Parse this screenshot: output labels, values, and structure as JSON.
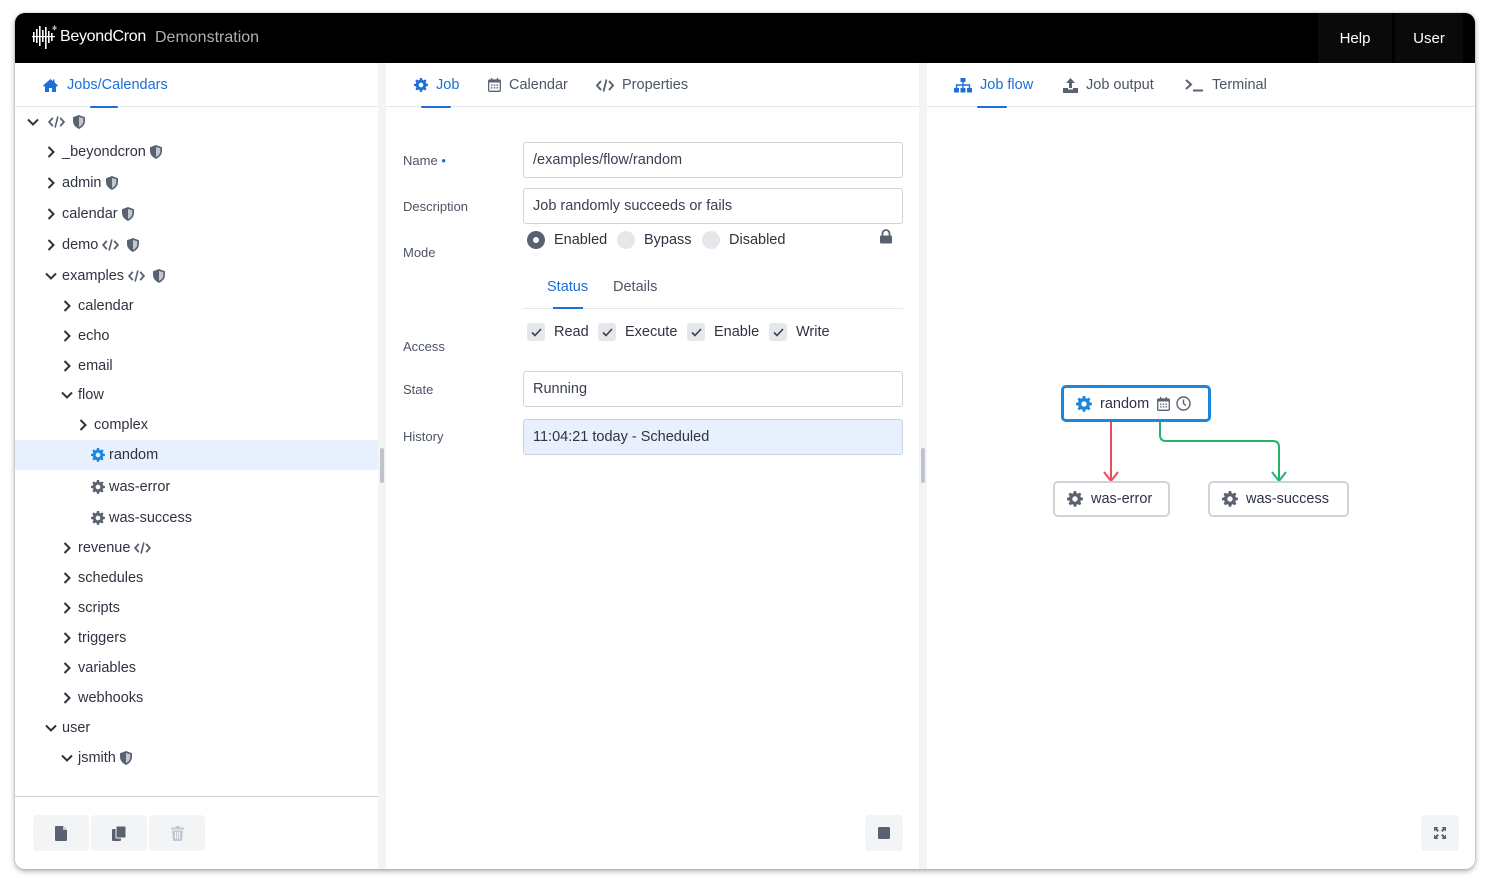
{
  "header": {
    "brand": "BeyondCron",
    "subtitle": "Demonstration",
    "help_label": "Help",
    "user_label": "User"
  },
  "left_panel": {
    "tab_label": "Jobs/Calendars",
    "tab_icon": "home-icon",
    "tree": [
      {
        "label": "",
        "depth": 0,
        "expanded": true,
        "icons": [
          "code-icon",
          "shield-icon"
        ]
      },
      {
        "label": "_beyondcron",
        "depth": 1,
        "expanded": false,
        "icons": [
          "shield-icon"
        ]
      },
      {
        "label": "admin",
        "depth": 1,
        "expanded": false,
        "icons": [
          "shield-icon"
        ]
      },
      {
        "label": "calendar",
        "depth": 1,
        "expanded": false,
        "icons": [
          "shield-icon"
        ]
      },
      {
        "label": "demo",
        "depth": 1,
        "expanded": false,
        "icons": [
          "code-icon",
          "shield-icon"
        ]
      },
      {
        "label": "examples",
        "depth": 1,
        "expanded": true,
        "icons": [
          "code-icon",
          "shield-icon"
        ]
      },
      {
        "label": "calendar",
        "depth": 2,
        "expanded": false,
        "icons": []
      },
      {
        "label": "echo",
        "depth": 2,
        "expanded": false,
        "icons": []
      },
      {
        "label": "email",
        "depth": 2,
        "expanded": false,
        "icons": []
      },
      {
        "label": "flow",
        "depth": 2,
        "expanded": true,
        "icons": []
      },
      {
        "label": "complex",
        "depth": 3,
        "expanded": false,
        "icons": []
      },
      {
        "label": "random",
        "depth": 3,
        "job": true,
        "selected": true,
        "icons": []
      },
      {
        "label": "was-error",
        "depth": 3,
        "job": true,
        "icons": []
      },
      {
        "label": "was-success",
        "depth": 3,
        "job": true,
        "icons": []
      },
      {
        "label": "revenue",
        "depth": 2,
        "expanded": false,
        "icons": [
          "code-icon"
        ]
      },
      {
        "label": "schedules",
        "depth": 2,
        "expanded": false,
        "icons": []
      },
      {
        "label": "scripts",
        "depth": 2,
        "expanded": false,
        "icons": []
      },
      {
        "label": "triggers",
        "depth": 2,
        "expanded": false,
        "icons": []
      },
      {
        "label": "variables",
        "depth": 2,
        "expanded": false,
        "icons": []
      },
      {
        "label": "webhooks",
        "depth": 2,
        "expanded": false,
        "icons": []
      },
      {
        "label": "user",
        "depth": 1,
        "expanded": true,
        "icons": []
      },
      {
        "label": "jsmith",
        "depth": 2,
        "expanded": true,
        "icons": [
          "shield-icon"
        ]
      }
    ],
    "footer_buttons": [
      {
        "name": "new-file-button",
        "icon": "file-icon",
        "enabled": true
      },
      {
        "name": "copy-button",
        "icon": "copy-icon",
        "enabled": true
      },
      {
        "name": "delete-button",
        "icon": "trash-icon",
        "enabled": false
      }
    ]
  },
  "middle_panel": {
    "tabs": [
      {
        "label": "Job",
        "icon": "gear-icon",
        "active": true
      },
      {
        "label": "Calendar",
        "icon": "calendar-icon",
        "active": false
      },
      {
        "label": "Properties",
        "icon": "code-icon",
        "active": false
      }
    ],
    "form": {
      "name_label": "Name",
      "name_required_marker": "•",
      "name_value": "/examples/flow/random",
      "description_label": "Description",
      "description_value": "Job randomly succeeds or fails",
      "mode_label": "Mode",
      "mode_options": [
        "Enabled",
        "Bypass",
        "Disabled"
      ],
      "mode_selected": "Enabled",
      "mode_locked": true
    },
    "subtabs": [
      {
        "label": "Status",
        "active": true
      },
      {
        "label": "Details",
        "active": false
      }
    ],
    "status": {
      "access_label": "Access",
      "access_options": [
        {
          "label": "Read",
          "checked": true
        },
        {
          "label": "Execute",
          "checked": true
        },
        {
          "label": "Enable",
          "checked": true
        },
        {
          "label": "Write",
          "checked": true
        }
      ],
      "state_label": "State",
      "state_value": "Running",
      "history_label": "History",
      "history_items": [
        "11:04:21 today - Scheduled"
      ]
    },
    "stop_button_icon": "stop-icon"
  },
  "right_panel": {
    "tabs": [
      {
        "label": "Job flow",
        "icon": "sitemap-icon",
        "active": true
      },
      {
        "label": "Job output",
        "icon": "upload-icon",
        "active": false
      },
      {
        "label": "Terminal",
        "icon": "terminal-icon",
        "active": false
      }
    ],
    "flow": {
      "root": {
        "label": "random",
        "badges": [
          "calendar-icon",
          "clock-icon"
        ]
      },
      "children": [
        {
          "label": "was-error",
          "edge": "error",
          "edge_color": "#f0495a"
        },
        {
          "label": "was-success",
          "edge": "success",
          "edge_color": "#22b56a"
        }
      ]
    },
    "expand_button_icon": "expand-icon"
  },
  "colors": {
    "accent": "#1a6fd9",
    "node_active_border": "#1a86e0",
    "selection_bg": "#e8f0fd",
    "error_edge": "#f0495a",
    "success_edge": "#22b56a"
  }
}
